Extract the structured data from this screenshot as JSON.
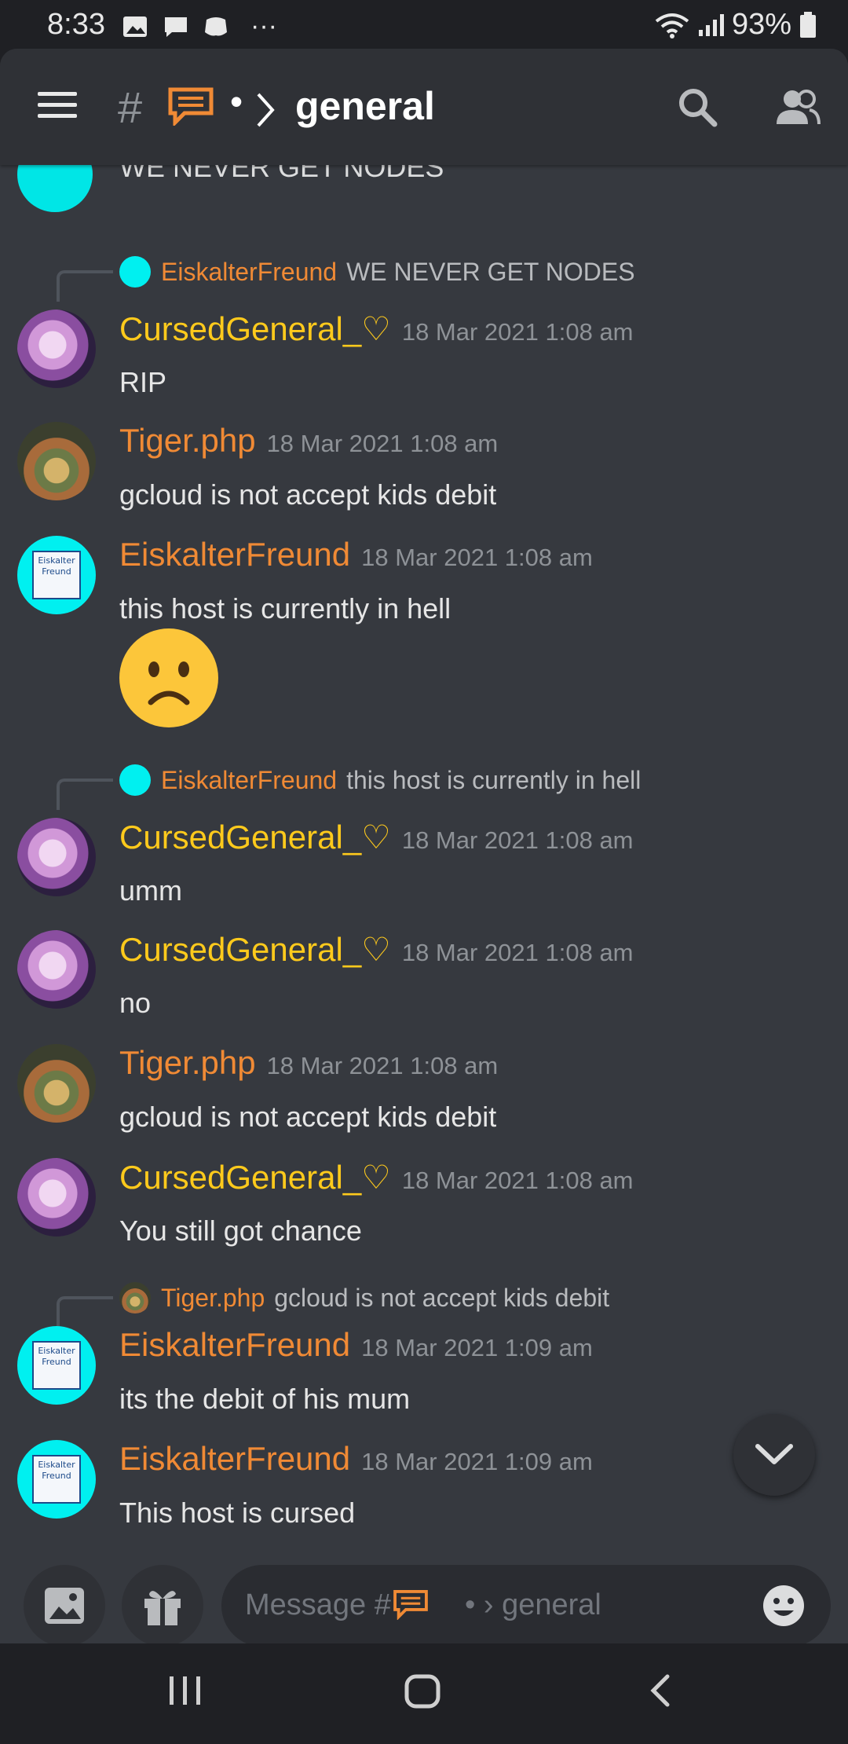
{
  "status_bar": {
    "time": "8:33",
    "battery": "93%",
    "more": "···"
  },
  "header": {
    "hash": "#",
    "separator": "•",
    "channel": "general"
  },
  "cutoff_message": {
    "text": "WE NEVER GET NODES"
  },
  "messages": [
    {
      "reply": {
        "name": "EiskalterFreund",
        "text": "WE NEVER GET NODES"
      },
      "author": "CursedGeneral_♡",
      "timestamp": "18 Mar 2021 1:08 am",
      "text": "RIP"
    },
    {
      "author": "Tiger.php",
      "timestamp": "18 Mar 2021 1:08 am",
      "text": "gcloud is not accept kids debit"
    },
    {
      "author": "EiskalterFreund",
      "timestamp": "18 Mar 2021 1:08 am",
      "text": "this host is currently in hell"
    },
    {
      "reply": {
        "name": "EiskalterFreund",
        "text": "this host is currently in hell"
      },
      "author": "CursedGeneral_♡",
      "timestamp": "18 Mar 2021 1:08 am",
      "text": "umm"
    },
    {
      "author": "CursedGeneral_♡",
      "timestamp": "18 Mar 2021 1:08 am",
      "text": "no"
    },
    {
      "author": "Tiger.php",
      "timestamp": "18 Mar 2021 1:08 am",
      "text": "gcloud is not accept kids debit"
    },
    {
      "author": "CursedGeneral_♡",
      "timestamp": "18 Mar 2021 1:08 am",
      "text": "You still got chance"
    },
    {
      "reply": {
        "name": "Tiger.php",
        "text": "gcloud is not accept kids debit"
      },
      "author": "EiskalterFreund",
      "timestamp": "18 Mar 2021 1:09 am",
      "text": "its the debit of his mum"
    },
    {
      "author": "EiskalterFreund",
      "timestamp": "18 Mar 2021 1:09 am",
      "text": "This host is cursed",
      "text2": "..."
    }
  ],
  "avatar_label": {
    "line1": "Eiskalter",
    "line2": "Freund"
  },
  "composer": {
    "placeholder": "Message #",
    "channel": "• › general"
  },
  "colors": {
    "background": "#36393f",
    "header": "#2f3136",
    "name_yellow": "#ffca1c",
    "name_orange": "#f08a35",
    "timestamp": "#8e9297"
  },
  "icons": [
    "menu-icon",
    "chat-emoji-icon",
    "chevron-right-icon",
    "search-icon",
    "members-icon",
    "image-icon",
    "gift-icon",
    "emoji-icon",
    "chevron-down-icon",
    "recent-apps-icon",
    "home-icon",
    "back-icon"
  ]
}
